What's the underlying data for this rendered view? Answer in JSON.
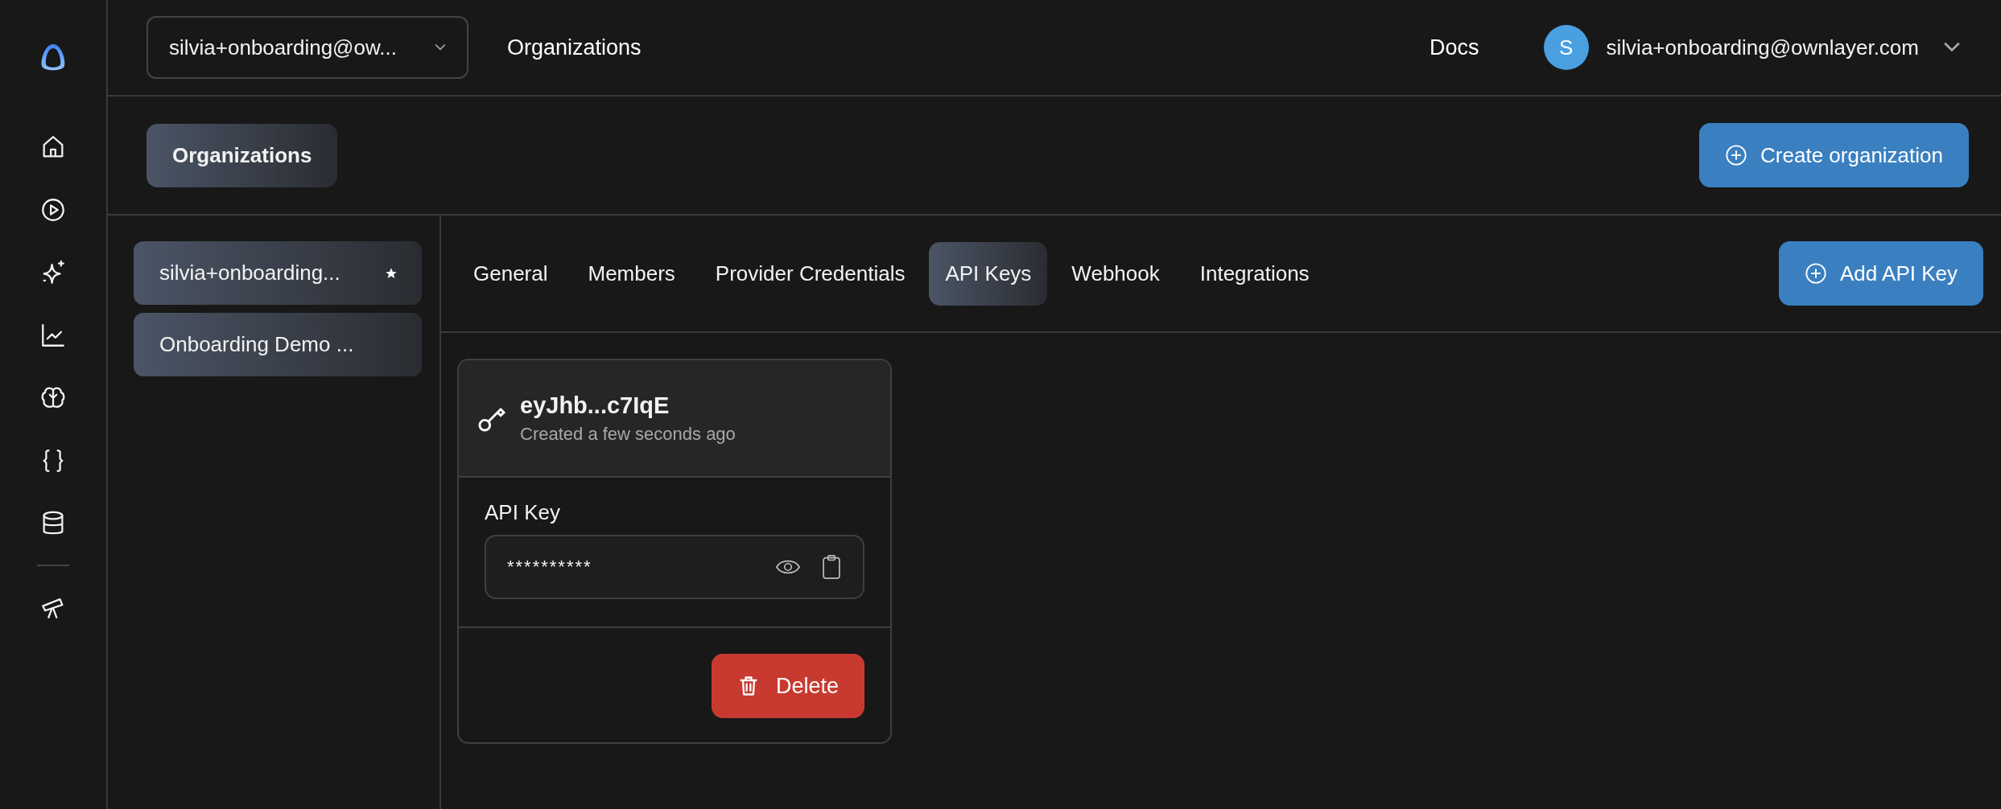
{
  "topbar": {
    "org_select": "silvia+onboarding@ow...",
    "nav_link": "Organizations",
    "docs_link": "Docs",
    "user": {
      "initial": "S",
      "email": "silvia+onboarding@ownlayer.com"
    }
  },
  "page_header": {
    "title": "Organizations",
    "create_button": "Create organization"
  },
  "organizations": [
    {
      "name": "silvia+onboarding...",
      "starred": true
    },
    {
      "name": "Onboarding Demo ...",
      "starred": false
    }
  ],
  "tabs": [
    {
      "label": "General",
      "selected": false
    },
    {
      "label": "Members",
      "selected": false
    },
    {
      "label": "Provider Credentials",
      "selected": false
    },
    {
      "label": "API Keys",
      "selected": true
    },
    {
      "label": "Webhook",
      "selected": false
    },
    {
      "label": "Integrations",
      "selected": false
    }
  ],
  "add_button": "Add API Key",
  "api_keys": [
    {
      "name": "eyJhb...c7IqE",
      "created": "Created a few seconds ago",
      "field_label": "API Key",
      "value": "**********",
      "delete_label": "Delete"
    }
  ]
}
